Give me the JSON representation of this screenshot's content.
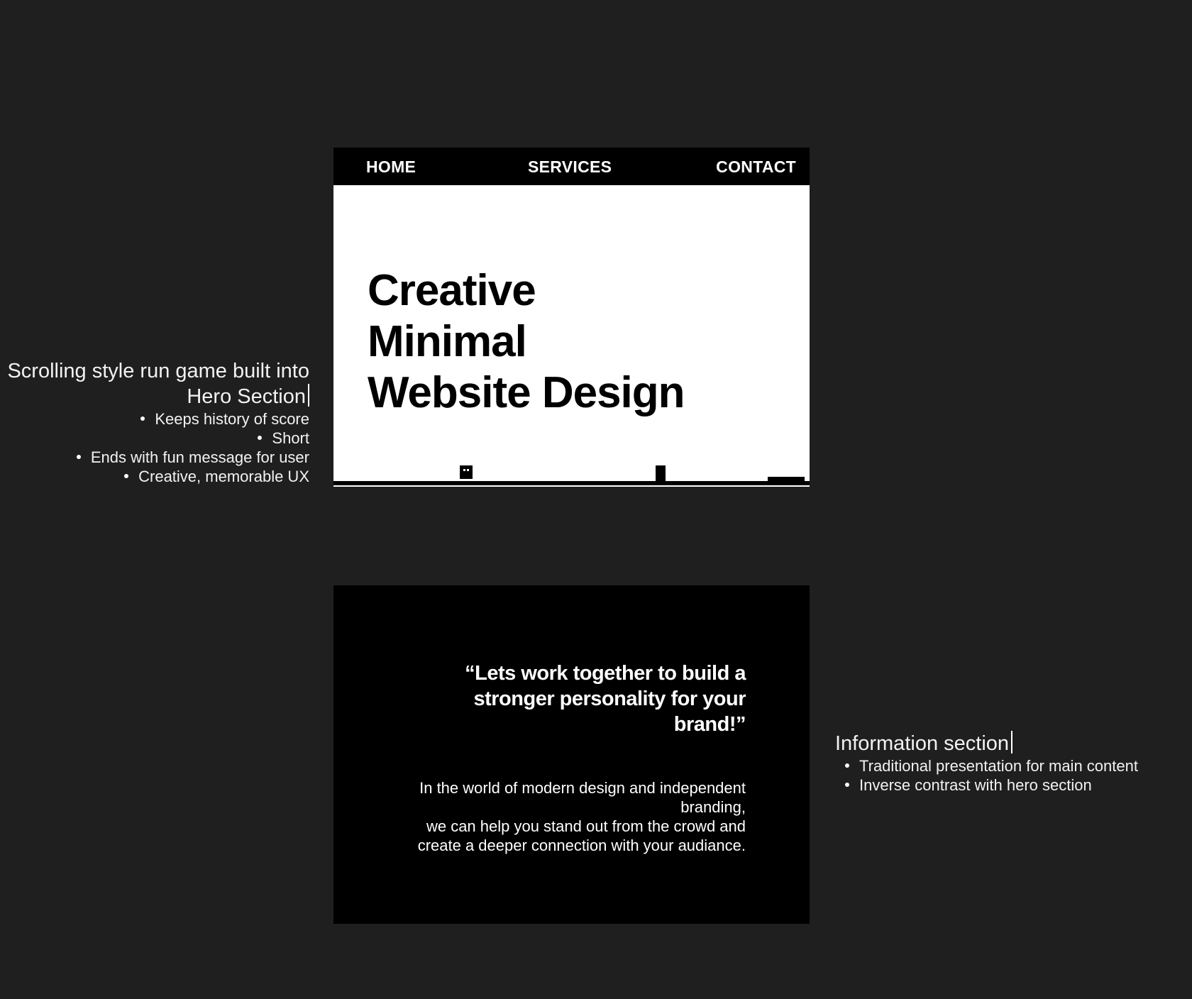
{
  "annotations": {
    "hero": {
      "title": "Scrolling style run game built into Hero Section",
      "points": [
        "Keeps history of score",
        "Short",
        "Ends with fun message for user",
        "Creative, memorable UX"
      ]
    },
    "info": {
      "title": "Information section",
      "points": [
        "Traditional presentation for main content",
        "Inverse contrast with hero section"
      ]
    }
  },
  "hero": {
    "nav": {
      "home": "HOME",
      "services": "SERVICES",
      "contact": "CONTACT"
    },
    "headline": [
      "Creative",
      "Minimal",
      "Website Design"
    ],
    "game": {
      "icons": [
        "player-icon",
        "obstacle-icon",
        "block-icon"
      ]
    }
  },
  "info": {
    "quote": "“Lets work together to build a stronger personality for your brand!”",
    "body": [
      "In the world of modern design and independent branding,",
      "we can help you stand out from the crowd and create a deeper connection with your audiance."
    ]
  },
  "colors": {
    "canvas": "#1f1f1f",
    "hero_bg": "#ffffff",
    "nav_bg": "#000000",
    "info_bg": "#000000",
    "text_light": "#ffffff",
    "text_dark": "#000000"
  }
}
